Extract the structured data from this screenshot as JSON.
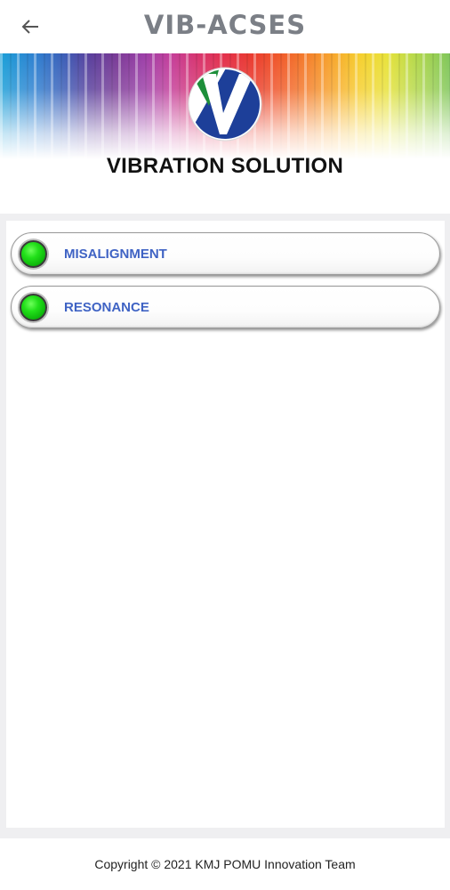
{
  "header": {
    "title": "VIB-ACSES",
    "back_icon": "arrow-left-icon"
  },
  "banner": {
    "title": "VIBRATION SOLUTION",
    "logo_letter": "V",
    "logo_colors": {
      "green": "#1d8f3a",
      "blue": "#1d3f99"
    }
  },
  "menu": {
    "items": [
      {
        "label": "MISALIGNMENT",
        "indicator_color": "#22e01a"
      },
      {
        "label": "RESONANCE",
        "indicator_color": "#22e01a"
      }
    ]
  },
  "footer": {
    "copyright": "Copyright © 2021 KMJ POMU Innovation Team"
  },
  "colors": {
    "title_gray": "#7b7f86",
    "item_label_blue": "#3f63c4"
  }
}
